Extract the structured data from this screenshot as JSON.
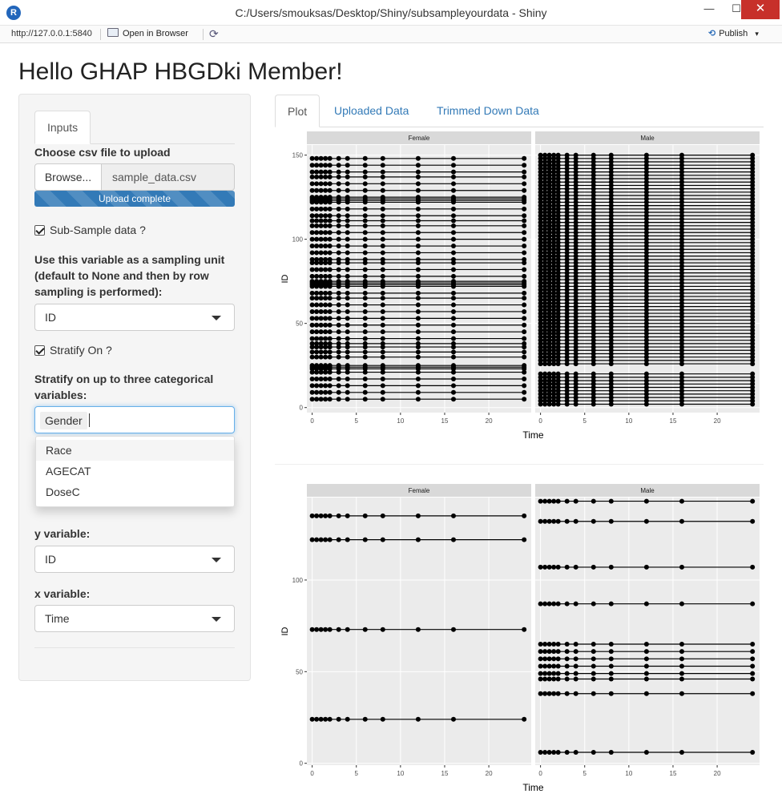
{
  "window": {
    "title": "C:/Users/smouksas/Desktop/Shiny/subsampleyourdata - Shiny",
    "app_icon_letter": "R",
    "minimize_glyph": "—",
    "maximize_glyph": "☐",
    "close_glyph": "✕"
  },
  "toolbar": {
    "url": "http://127.0.0.1:5840",
    "open_in_browser": "Open in Browser",
    "refresh_glyph": "⟳",
    "publish": "Publish",
    "publish_glyph": "⟲",
    "publish_caret": "▾"
  },
  "page": {
    "title": "Hello GHAP HBGDki Member!"
  },
  "sidebar": {
    "tab": "Inputs",
    "upload_label": "Choose csv file to upload",
    "browse_label": "Browse...",
    "file_name": "sample_data.csv",
    "upload_progress_text": "Upload complete",
    "upload_progress": 1.0,
    "subsample_label": "Sub-Sample data ?",
    "subsample_checked": true,
    "sampling_unit_label": "Use this variable as a sampling unit (default to None and then by row sampling is performed):",
    "sampling_unit_value": "ID",
    "stratify_label": "Stratify On ?",
    "stratify_checked": true,
    "stratify_vars_label": "Stratify on up to three categorical variables:",
    "stratify_selected": "Gender",
    "stratify_options": [
      "Race",
      "AGECAT",
      "DoseC"
    ],
    "y_label": "y variable:",
    "y_value": "ID",
    "x_label": "x variable:",
    "x_value": "Time"
  },
  "main": {
    "tabs": [
      "Plot",
      "Uploaded Data",
      "Trimmed Down Data"
    ],
    "active_tab": "Plot"
  },
  "colors": {
    "accent": "#337ab7",
    "focus_border": "#66afe9",
    "panel_bg": "#EBEBEB",
    "strip_bg": "#D9D9D9",
    "close_button": "#c7302a"
  },
  "chart_data": [
    {
      "type": "line",
      "facets": [
        "Female",
        "Male"
      ],
      "xlabel": "Time",
      "ylabel": "ID",
      "xlim": [
        -0.6,
        24.8
      ],
      "ylim": [
        -3,
        156
      ],
      "x_ticks": [
        0,
        5,
        10,
        15,
        20
      ],
      "y_ticks": [
        0,
        50,
        100,
        150
      ],
      "time_points": [
        0,
        0.5,
        1,
        1.5,
        2,
        3,
        4,
        6,
        8,
        12,
        16,
        24
      ],
      "panels": [
        {
          "facet": "Female",
          "ids": [
            5,
            9,
            13,
            17,
            21,
            23,
            24,
            25,
            30,
            33,
            36,
            38,
            41,
            45,
            49,
            53,
            57,
            61,
            65,
            68,
            72,
            73,
            74,
            75,
            78,
            82,
            86,
            88,
            92,
            96,
            100,
            104,
            108,
            111,
            114,
            118,
            122,
            123,
            124,
            125,
            129,
            133,
            137,
            140,
            144,
            148
          ]
        },
        {
          "facet": "Male",
          "ids": [
            2,
            4,
            6,
            8,
            10,
            12,
            14,
            16,
            18,
            20,
            26,
            28,
            30,
            32,
            34,
            36,
            38,
            40,
            42,
            44,
            46,
            48,
            50,
            52,
            54,
            56,
            58,
            60,
            62,
            64,
            66,
            68,
            70,
            72,
            74,
            76,
            78,
            80,
            82,
            84,
            86,
            88,
            90,
            92,
            94,
            96,
            98,
            100,
            102,
            104,
            106,
            108,
            110,
            112,
            114,
            116,
            118,
            120,
            122,
            124,
            126,
            128,
            130,
            132,
            134,
            136,
            138,
            140,
            142,
            144,
            146,
            148,
            150
          ]
        }
      ]
    },
    {
      "type": "line",
      "facets": [
        "Female",
        "Male"
      ],
      "xlabel": "Time",
      "ylabel": "ID",
      "xlim": [
        -0.6,
        24.8
      ],
      "ylim": [
        -1,
        145
      ],
      "x_ticks": [
        0,
        5,
        10,
        15,
        20
      ],
      "y_ticks": [
        0,
        50,
        100
      ],
      "time_points": [
        0,
        0.5,
        1,
        1.5,
        2,
        3,
        4,
        6,
        8,
        12,
        16,
        24
      ],
      "panels": [
        {
          "facet": "Female",
          "ids": [
            24,
            73,
            122,
            135
          ]
        },
        {
          "facet": "Male",
          "ids": [
            6,
            38,
            46,
            49,
            53,
            57,
            61,
            65,
            87,
            107,
            132,
            143
          ]
        }
      ]
    }
  ]
}
